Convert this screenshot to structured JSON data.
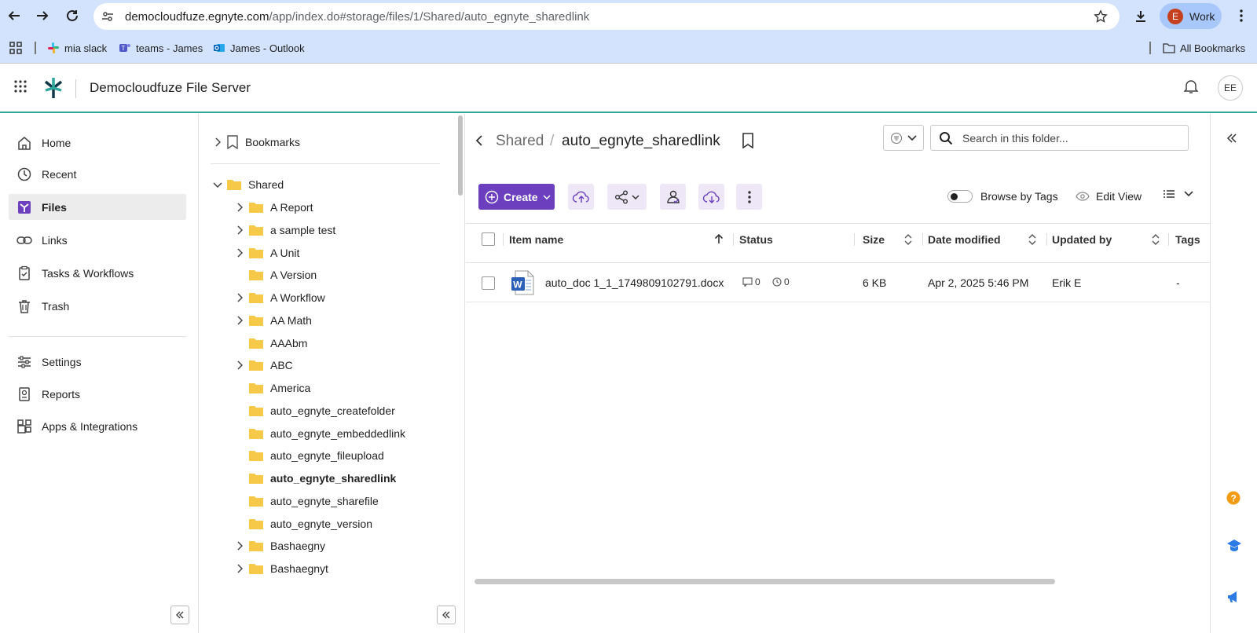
{
  "browser": {
    "url_host": "democloudfuze.egnyte.com",
    "url_path": "/app/index.do#storage/files/1/Shared/auto_egnyte_sharedlink",
    "profile_initial": "E",
    "profile_label": "Work",
    "bookmarks": [
      "mia slack",
      "teams - James",
      "James - Outlook"
    ],
    "all_bookmarks": "All Bookmarks"
  },
  "app": {
    "title": "Democloudfuze File Server",
    "user_initials": "EE",
    "accent_color": "#6b3fbd",
    "header_rule_color": "#2fa699"
  },
  "nav": {
    "primary": [
      {
        "label": "Home",
        "icon": "home-icon"
      },
      {
        "label": "Recent",
        "icon": "clock-icon"
      },
      {
        "label": "Files",
        "icon": "files-icon",
        "active": true
      },
      {
        "label": "Links",
        "icon": "link-icon"
      },
      {
        "label": "Tasks & Workflows",
        "icon": "clipboard-icon"
      },
      {
        "label": "Trash",
        "icon": "trash-icon"
      }
    ],
    "secondary": [
      {
        "label": "Settings",
        "icon": "sliders-icon"
      },
      {
        "label": "Reports",
        "icon": "reports-icon"
      },
      {
        "label": "Apps & Integrations",
        "icon": "apps-icon"
      }
    ]
  },
  "tree": {
    "bookmarks_label": "Bookmarks",
    "root_label": "Shared",
    "folders": [
      {
        "label": "A Report",
        "expandable": true
      },
      {
        "label": "a sample test",
        "expandable": true
      },
      {
        "label": "A Unit",
        "expandable": true
      },
      {
        "label": "A Version",
        "expandable": false
      },
      {
        "label": "A Workflow",
        "expandable": true
      },
      {
        "label": "AA Math",
        "expandable": true
      },
      {
        "label": "AAAbm",
        "expandable": false
      },
      {
        "label": "ABC",
        "expandable": true
      },
      {
        "label": "America",
        "expandable": false
      },
      {
        "label": "auto_egnyte_createfolder",
        "expandable": false
      },
      {
        "label": "auto_egnyte_embeddedlink",
        "expandable": false
      },
      {
        "label": "auto_egnyte_fileupload",
        "expandable": false
      },
      {
        "label": "auto_egnyte_sharedlink",
        "expandable": false,
        "selected": true
      },
      {
        "label": "auto_egnyte_sharefile",
        "expandable": false
      },
      {
        "label": "auto_egnyte_version",
        "expandable": false
      },
      {
        "label": "Bashaegny",
        "expandable": true
      },
      {
        "label": "Bashaegnyt",
        "expandable": true
      }
    ]
  },
  "main": {
    "breadcrumb_parent": "Shared",
    "breadcrumb_sep": "/",
    "breadcrumb_current": "auto_egnyte_sharedlink",
    "search_placeholder": "Search in this folder...",
    "create_label": "Create",
    "browse_by_tags": "Browse by Tags",
    "edit_view": "Edit View",
    "columns": [
      "Item name",
      "Status",
      "Size",
      "Date modified",
      "Updated by",
      "Tags"
    ],
    "rows": [
      {
        "name": "auto_doc 1_1_1749809102791.docx",
        "comments": "0",
        "versions": "0",
        "size": "6 KB",
        "modified": "Apr 2, 2025 5:46 PM",
        "updated_by": "Erik E",
        "tags": "-"
      }
    ]
  }
}
